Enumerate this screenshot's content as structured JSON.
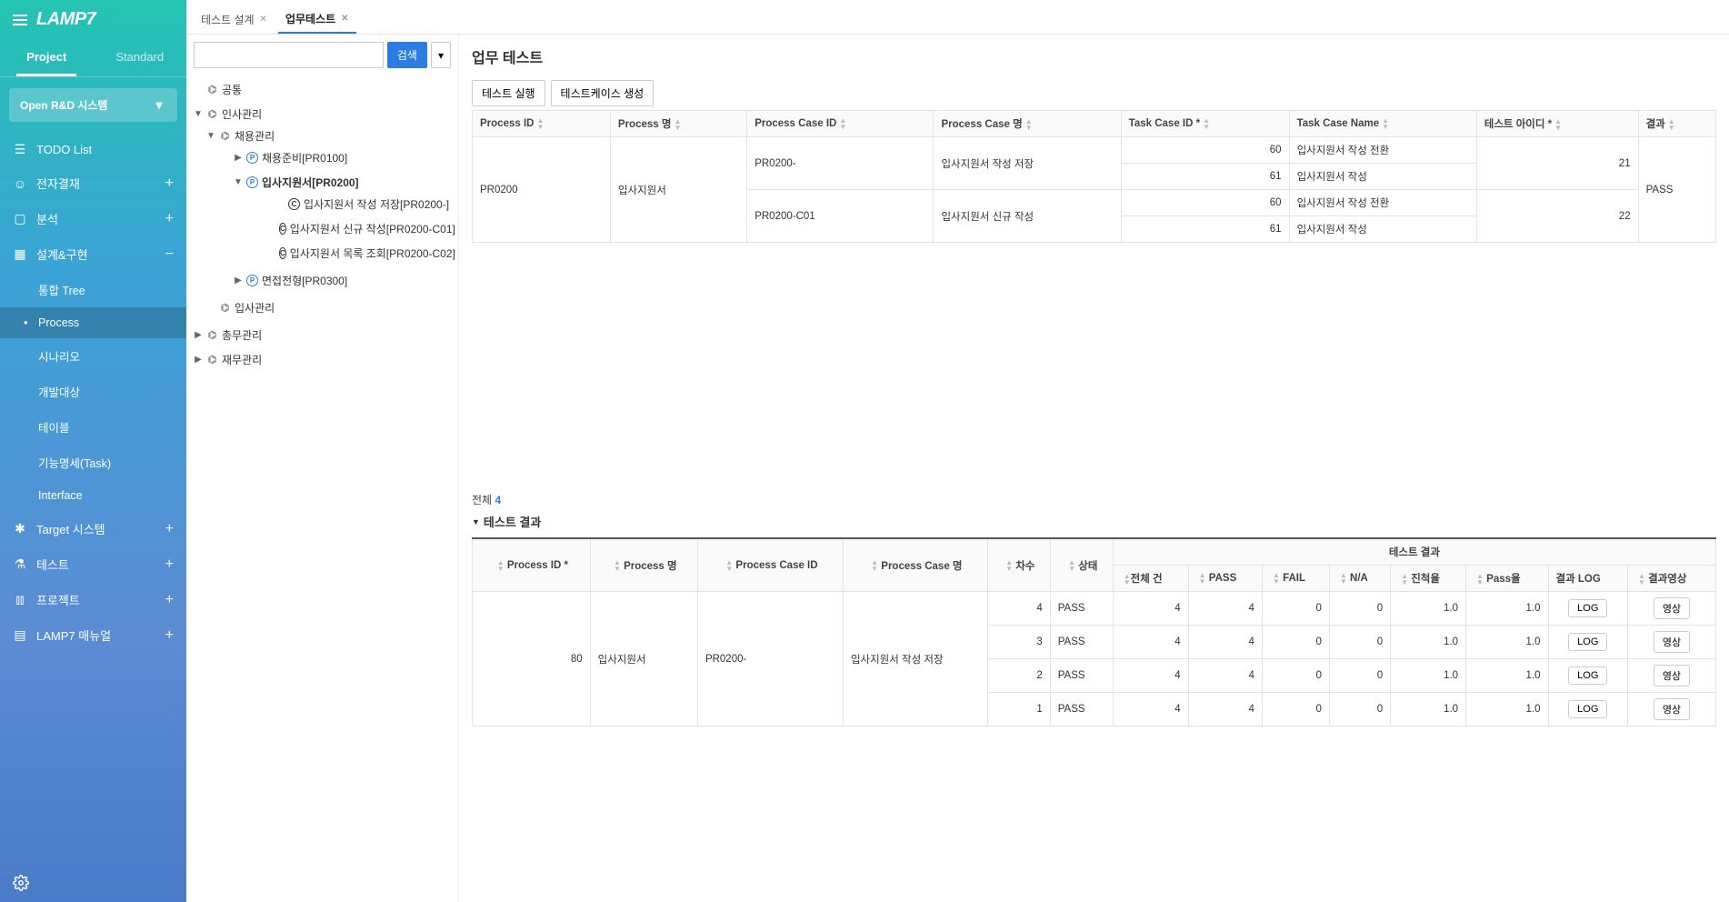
{
  "logo": "LAMP7",
  "sidebarTabs": {
    "project": "Project",
    "standard": "Standard"
  },
  "projectSelect": "Open R&D 시스템",
  "nav": {
    "todo": "TODO List",
    "approval": "전자결재",
    "analysis": "분석",
    "design": "설계&구현",
    "designSub": {
      "tree": "통합 Tree",
      "process": "Process",
      "scenario": "시나리오",
      "devtarget": "개발대상",
      "table": "테이블",
      "task": "기능명세(Task)",
      "interface": "Interface"
    },
    "target": "Target 시스템",
    "test": "테스트",
    "projectMenu": "프로젝트",
    "manual": "LAMP7 매뉴얼"
  },
  "tabs": [
    {
      "label": "테스트 설계",
      "active": false
    },
    {
      "label": "업무테스트",
      "active": true
    }
  ],
  "searchBtn": "검색",
  "tree": {
    "common": "공통",
    "hr": "인사관리",
    "recruit": "채용관리",
    "pr0100": "채용준비[PR0100]",
    "pr0200": "입사지원서[PR0200]",
    "pr0200_1": "입사지원서 작성 저장[PR0200-]",
    "pr0200_c01": "입사지원서 신규 작성[PR0200-C01]",
    "pr0200_c02": "입사지원서 목록 조회[PR0200-C02]",
    "pr0300": "면접전형[PR0300]",
    "insa": "입사관리",
    "finance": "총무관리",
    "account": "재무관리"
  },
  "pageTitle": "업무 테스트",
  "toolbar": {
    "run": "테스트 실행",
    "gen": "테스트케이스 생성"
  },
  "cols1": {
    "pid": "Process ID",
    "pname": "Process 명",
    "pcid": "Process Case ID",
    "pcname": "Process Case 명",
    "tcid": "Task Case ID *",
    "tcname": "Task Case Name",
    "tid": "테스트 아이디 *",
    "result": "결과"
  },
  "grid1": {
    "pid": "PR0200",
    "pname": "입사지원서",
    "cases": [
      {
        "pcid": "PR0200-",
        "pcname": "입사지원서 작성 저장",
        "tid": "21",
        "tasks": [
          {
            "tcid": "60",
            "tcname": "입사지원서 작성 전환"
          },
          {
            "tcid": "61",
            "tcname": "입사지원서 작성"
          }
        ]
      },
      {
        "pcid": "PR0200-C01",
        "pcname": "입사지원서 신규 작성",
        "tid": "22",
        "tasks": [
          {
            "tcid": "60",
            "tcname": "입사지원서 작성 전환"
          },
          {
            "tcid": "61",
            "tcname": "입사지원서 작성"
          }
        ]
      }
    ],
    "result": "PASS"
  },
  "pager": {
    "label": "전체",
    "count": "4"
  },
  "resultsTitle": "테스트 결과",
  "cols2": {
    "pid": "Process ID *",
    "pname": "Process 명",
    "pcid": "Process Case ID",
    "pcname": "Process Case 명",
    "round": "차수",
    "status": "상태",
    "group": "테스트 결과",
    "total": "전체 건",
    "pass": "PASS",
    "fail": "FAIL",
    "na": "N/A",
    "progress": "진척율",
    "passrate": "Pass율",
    "log": "결과 LOG",
    "video": "결과영상"
  },
  "grid2": {
    "pid": "80",
    "pname": "입사지원서",
    "pcid": "PR0200-",
    "pcname": "입사지원서 작성 저장",
    "rows": [
      {
        "round": "4",
        "status": "PASS",
        "total": "4",
        "pass": "4",
        "fail": "0",
        "na": "0",
        "progress": "1.0",
        "passrate": "1.0"
      },
      {
        "round": "3",
        "status": "PASS",
        "total": "4",
        "pass": "4",
        "fail": "0",
        "na": "0",
        "progress": "1.0",
        "passrate": "1.0"
      },
      {
        "round": "2",
        "status": "PASS",
        "total": "4",
        "pass": "4",
        "fail": "0",
        "na": "0",
        "progress": "1.0",
        "passrate": "1.0"
      },
      {
        "round": "1",
        "status": "PASS",
        "total": "4",
        "pass": "4",
        "fail": "0",
        "na": "0",
        "progress": "1.0",
        "passrate": "1.0"
      }
    ],
    "logBtn": "LOG",
    "videoBtn": "영상"
  }
}
